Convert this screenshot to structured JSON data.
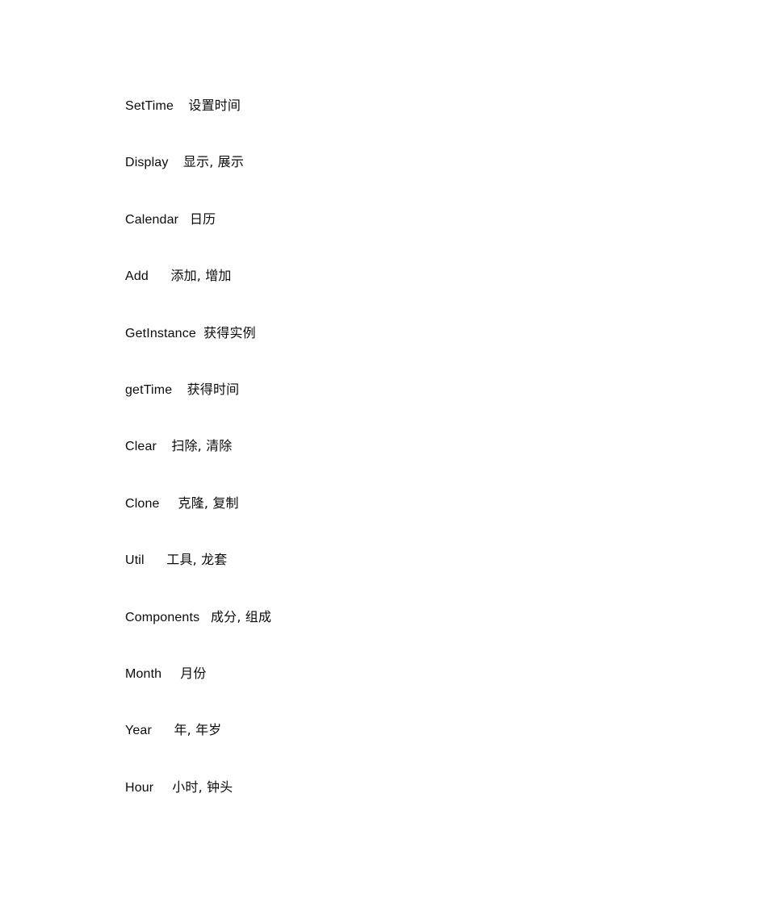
{
  "document": {
    "type": "glossary",
    "page_background": "#ffffff",
    "text_color": "#0b0b0b",
    "entries": [
      {
        "term": "SetTime",
        "gap": "    ",
        "gloss": "设置时间"
      },
      {
        "term": "Display",
        "gap": "    ",
        "gloss": "显示, 展示"
      },
      {
        "term": "Calendar",
        "gap": "   ",
        "gloss": "日历"
      },
      {
        "term": "Add",
        "gap": "      ",
        "gloss": "添加, 增加"
      },
      {
        "term": "GetInstance",
        "gap": "  ",
        "gloss": "获得实例"
      },
      {
        "term": "getTime",
        "gap": "    ",
        "gloss": "获得时间"
      },
      {
        "term": "Clear",
        "gap": "    ",
        "gloss": "扫除, 清除"
      },
      {
        "term": "Clone",
        "gap": "     ",
        "gloss": "克隆, 复制"
      },
      {
        "term": "Util",
        "gap": "      ",
        "gloss": "工具, 龙套"
      },
      {
        "term": "Components",
        "gap": "   ",
        "gloss": "成分, 组成"
      },
      {
        "term": "Month",
        "gap": "     ",
        "gloss": "月份"
      },
      {
        "term": "Year",
        "gap": "      ",
        "gloss": "年, 年岁"
      },
      {
        "term": "Hour",
        "gap": "     ",
        "gloss": "小时, 钟头"
      }
    ]
  }
}
